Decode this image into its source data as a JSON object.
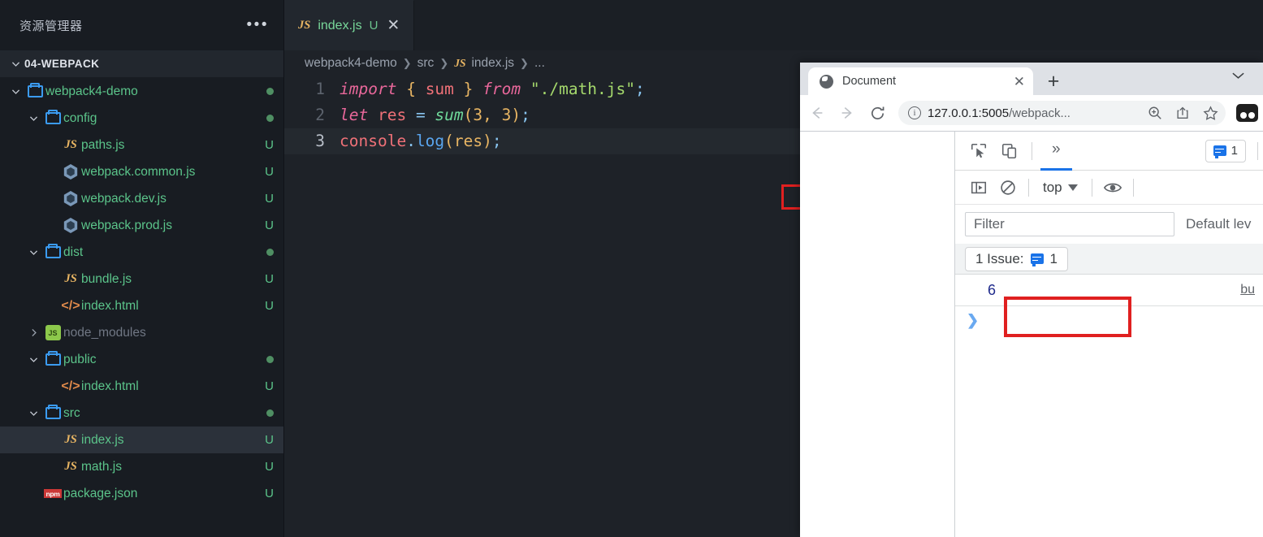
{
  "vscode": {
    "sidebar": {
      "header_title": "资源管理器",
      "more_icon": "ellipsis-icon",
      "root_label": "04-WEBPACK",
      "tree": [
        {
          "label": "webpack4-demo",
          "icon": "folder-icon",
          "depth": 1,
          "expanded": true,
          "status": "dot",
          "kind": "folder"
        },
        {
          "label": "config",
          "icon": "folder-icon",
          "depth": 2,
          "expanded": true,
          "status": "dot",
          "kind": "folder"
        },
        {
          "label": "paths.js",
          "icon": "js-icon",
          "depth": 3,
          "status": "U",
          "kind": "file"
        },
        {
          "label": "webpack.common.js",
          "icon": "webpack-icon",
          "depth": 3,
          "status": "U",
          "kind": "file"
        },
        {
          "label": "webpack.dev.js",
          "icon": "webpack-icon",
          "depth": 3,
          "status": "U",
          "kind": "file"
        },
        {
          "label": "webpack.prod.js",
          "icon": "webpack-icon",
          "depth": 3,
          "status": "U",
          "kind": "file"
        },
        {
          "label": "dist",
          "icon": "folder-icon",
          "depth": 2,
          "expanded": true,
          "status": "dot",
          "kind": "folder"
        },
        {
          "label": "bundle.js",
          "icon": "js-icon",
          "depth": 3,
          "status": "U",
          "kind": "file"
        },
        {
          "label": "index.html",
          "icon": "html-icon",
          "depth": 3,
          "status": "U",
          "kind": "file"
        },
        {
          "label": "node_modules",
          "icon": "node-icon",
          "depth": 2,
          "expanded": false,
          "status": "",
          "kind": "folder",
          "dim": true
        },
        {
          "label": "public",
          "icon": "folder-icon",
          "depth": 2,
          "expanded": true,
          "status": "dot",
          "kind": "folder"
        },
        {
          "label": "index.html",
          "icon": "html-icon",
          "depth": 3,
          "status": "U",
          "kind": "file"
        },
        {
          "label": "src",
          "icon": "folder-icon",
          "depth": 2,
          "expanded": true,
          "status": "dot",
          "kind": "folder"
        },
        {
          "label": "index.js",
          "icon": "js-icon",
          "depth": 3,
          "status": "U",
          "kind": "file",
          "selected": true
        },
        {
          "label": "math.js",
          "icon": "js-icon",
          "depth": 3,
          "status": "U",
          "kind": "file"
        },
        {
          "label": "package.json",
          "icon": "npm-icon",
          "depth": 2,
          "status": "U",
          "kind": "file"
        }
      ]
    },
    "tab": {
      "icon": "js-icon",
      "name": "index.js",
      "dirty_badge": "U",
      "close_icon": "close-icon"
    },
    "breadcrumb": {
      "items": [
        "webpack4-demo",
        "src",
        "index.js",
        "..."
      ],
      "file_icon": "js-icon",
      "separator": "›"
    },
    "code": {
      "lines": [
        {
          "num": "1",
          "current": false
        },
        {
          "num": "2",
          "current": false
        },
        {
          "num": "3",
          "current": true
        }
      ],
      "line1": {
        "kw": "import",
        "brace_open": " { ",
        "ident": "sum",
        "brace_close": " } ",
        "from": "from",
        "str": " \"./math.js\"",
        "semi": ";"
      },
      "line2": {
        "kw": "let",
        "name": " res ",
        "eq": "= ",
        "fn": "sum",
        "args": "(3, 3)",
        "semi": ";"
      },
      "line3": {
        "obj": "console",
        "dot": ".",
        "method": "log",
        "args": "(res)",
        "semi": ";"
      },
      "highlight_note": "red-box-around-sum-call"
    }
  },
  "browser": {
    "tab": {
      "favicon": "globe-icon",
      "title": "Document",
      "close_icon": "close-icon"
    },
    "new_tab_icon": "plus-icon",
    "tab_list_icon": "chevron-down-icon",
    "nav": {
      "back_icon": "back-arrow-icon",
      "forward_icon": "forward-arrow-icon",
      "reload_icon": "reload-icon"
    },
    "omnibox": {
      "security_icon": "info-circle-icon",
      "url_host": "127.0.0.1:5005",
      "url_path": "/webpack...",
      "zoom_icon": "zoom-in-icon",
      "share_icon": "share-icon",
      "bookmark_icon": "star-icon"
    },
    "profile_icon": "profile-icon"
  },
  "devtools": {
    "toolbar": {
      "inspect_icon": "inspect-cursor-icon",
      "device_icon": "device-toolbar-icon",
      "more_tabs_icon": "chevrons-right-icon",
      "more_tabs_label": "»",
      "issues_badge": {
        "icon": "message-icon",
        "count": "1"
      }
    },
    "console_toolbar": {
      "sidebar_icon": "console-sidebar-icon",
      "clear_icon": "clear-console-icon",
      "context_label": "top",
      "context_caret": "caret-down-icon",
      "eye_icon": "eye-icon"
    },
    "filterbar": {
      "filter_placeholder": "Filter",
      "filter_value": "",
      "level_label": "Default lev"
    },
    "issue_banner": {
      "label": "1 Issue:",
      "icon": "message-icon",
      "count": "1"
    },
    "console_output": [
      {
        "value": "6",
        "source": "bu",
        "highlighted": true
      }
    ],
    "prompt_icon": "prompt-arrow-icon",
    "prompt_glyph": "❯"
  },
  "colors": {
    "vscode_bg": "#1e2228",
    "sidebar_bg": "#181c22",
    "accent_blue": "#1a73e8",
    "folder_blue": "#3b9bf0",
    "file_green": "#5bc48a",
    "highlight_red": "#e02020",
    "log_value_blue": "#1f2a8c"
  }
}
